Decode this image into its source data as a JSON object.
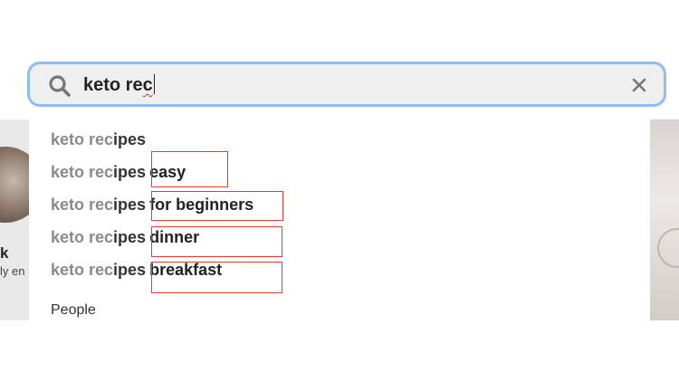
{
  "search": {
    "typed_main": "keto re",
    "typed_misspelled": "c",
    "value": "keto rec",
    "search_icon": "search-icon",
    "clear_icon": "close-icon"
  },
  "suggestions": [
    {
      "prefix": "keto rec",
      "rest": "ipes",
      "extra": ""
    },
    {
      "prefix": "keto rec",
      "rest": "ipes",
      "extra": "easy"
    },
    {
      "prefix": "keto rec",
      "rest": "ipes",
      "extra": "for beginners"
    },
    {
      "prefix": "keto rec",
      "rest": "ipes",
      "extra": "dinner"
    },
    {
      "prefix": "keto rec",
      "rest": "ipes",
      "extra": "breakfast"
    }
  ],
  "people_heading": "People",
  "background": {
    "name_fragment": "k",
    "sub_fragment": "ly en"
  },
  "colors": {
    "focus_border": "#8fbdf2",
    "search_bg": "#efefef",
    "annotation_red": "#e53935",
    "prefix_gray": "#8a8a8a"
  }
}
